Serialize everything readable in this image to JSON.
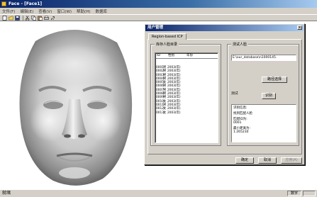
{
  "window": {
    "title": "Face - [Face1]"
  },
  "menu": [
    "文件(F)",
    "编辑(E)",
    "查看(V)",
    "窗口(W)",
    "帮助(H)",
    "数据库"
  ],
  "toolbar": [
    "new-file-icon",
    "open-folder-icon",
    "save-icon",
    "cut-icon",
    "copy-icon",
    "paste-icon",
    "print-icon",
    "help-icon"
  ],
  "status": {
    "text": "就绪",
    "num": "数字"
  },
  "dialog": {
    "title": "用户管理",
    "tab": "Region-based ICP",
    "list_group": "库存人脸目录",
    "list_columns": [
      "ID",
      "性别",
      "年份"
    ],
    "list_rows": [
      [
        "0001",
        "男",
        "2003(年)"
      ],
      [
        "0002",
        "男",
        "2003(年)"
      ],
      [
        "0003",
        "男",
        "2003(年)"
      ],
      [
        "0004",
        "男",
        "2003(年)"
      ],
      [
        "0005",
        "女",
        "2003(年)"
      ],
      [
        "0006",
        "男",
        "2003(年)"
      ],
      [
        "0007",
        "男",
        "2003(年)"
      ],
      [
        "0008",
        "男",
        "2003(年)"
      ],
      [
        "0009",
        "男",
        "2003(年)"
      ],
      [
        "0010",
        "女",
        "2003(年)"
      ],
      [
        "0011",
        "男",
        "2003(年)"
      ],
      [
        "0012",
        "女",
        "2003(年)"
      ],
      [
        "0013",
        "女",
        "2003(年)"
      ]
    ],
    "test_group": "测试人脸",
    "path_value": "E:\\our_database\\n1000145.",
    "select_path_button": "路径选择",
    "test_label": "测试",
    "identify_button": "识别",
    "result_header": "识别信息:",
    "result_found": "找到匹配人脸",
    "match_label": "匹配ID为:",
    "match_value": "0001",
    "distance_label": "最小距离为:",
    "distance_value": "1.265230",
    "ok_button": "确定",
    "cancel_button": "取消",
    "apply_button": "应用(A)"
  }
}
